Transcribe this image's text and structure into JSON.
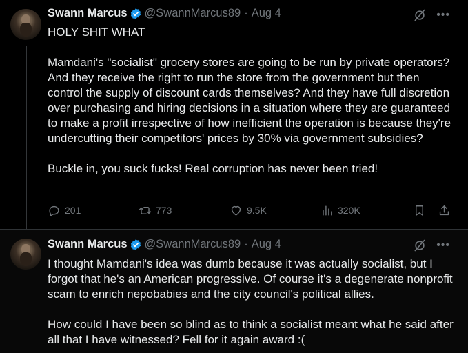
{
  "tweets": [
    {
      "author_name": "Swann Marcus",
      "handle": "@SwannMarcus89",
      "date": "Aug 4",
      "text": "HOLY SHIT WHAT\n\nMamdani's \"socialist\" grocery stores are going to be run by private operators? And they receive the right to run the store from the government but then control the supply of discount cards themselves? And they have full discretion over purchasing and hiring decisions in a situation where they are guaranteed to make a profit irrespective of how inefficient the operation is because they're undercutting their competitors' prices by 30% via government subsidies?\n\nBuckle in, you suck fucks! Real corruption has never been tried!",
      "replies": "201",
      "reposts": "773",
      "likes": "9.5K",
      "views": "320K"
    },
    {
      "author_name": "Swann Marcus",
      "handle": "@SwannMarcus89",
      "date": "Aug 4",
      "text": "I thought Mamdani's idea was dumb because it was actually socialist, but I forgot that he's an American progressive. Of course it's a degenerate nonprofit scam to enrich nepobabies and the city council's political allies.\n\nHow could I have been so blind as to think a socialist meant what he said after all that I have witnessed? Fell for it again award :("
    }
  ],
  "icons": {
    "verified": "verified-badge-icon",
    "grok": "grok-icon",
    "more": "more-icon",
    "reply": "reply-icon",
    "repost": "repost-icon",
    "like": "like-icon",
    "views": "views-icon",
    "bookmark": "bookmark-icon",
    "share": "share-icon"
  },
  "colors": {
    "background": "#000000",
    "text": "#e7e9ea",
    "muted": "#71767b",
    "verified": "#1d9bf0"
  }
}
